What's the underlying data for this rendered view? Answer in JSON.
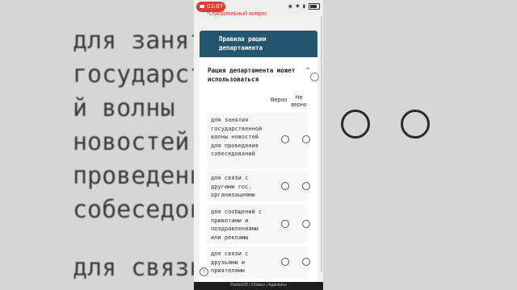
{
  "status_bar": {
    "time": "03:07",
    "icons": [
      "eye-icon",
      "bluetooth-icon",
      "signal-icon",
      "battery-icon"
    ],
    "battery_level": "51"
  },
  "required_note": "*Обязательный вопрос",
  "section": {
    "title": "Правила рации департамента"
  },
  "question": {
    "text": "Рация департамента может использоваться",
    "required_mark": "*"
  },
  "columns": [
    "Верно",
    "Не верно"
  ],
  "rows": [
    {
      "label": "для занятия государственной волны новостей для проведения собеседований"
    },
    {
      "label": "для связи с другими гос. организациями"
    },
    {
      "label": "для сообщений с приветами и поздравлениями или рекламы"
    },
    {
      "label": "для связи с друзьями и приятелями"
    }
  ],
  "caption": "Radmir20 | Обзвон | Адвокаты",
  "background_lines": [
    "для занят",
    "государст",
    "й волны",
    "новостей",
    "проведени",
    "собеседов",
    "для связи"
  ],
  "colors": {
    "header_bg": "#24566d",
    "required": "#d23a2f",
    "record": "#e23b30"
  }
}
